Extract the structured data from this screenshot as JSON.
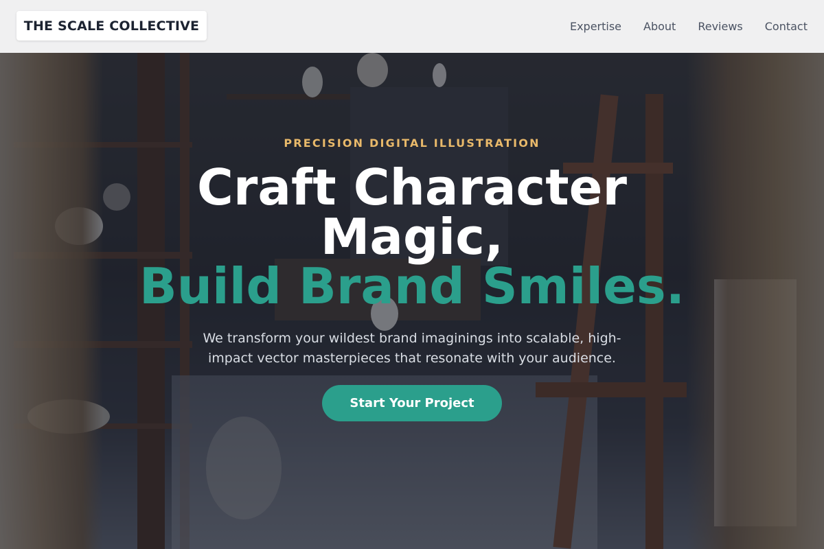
{
  "header": {
    "brand": "THE SCALE COLLECTIVE",
    "nav": [
      {
        "label": "Expertise"
      },
      {
        "label": "About"
      },
      {
        "label": "Reviews"
      },
      {
        "label": "Contact"
      }
    ]
  },
  "hero": {
    "eyebrow": "PRECISION DIGITAL ILLUSTRATION",
    "headline_line1": "Craft Character Magic,",
    "headline_accent": "Build Brand Smiles.",
    "subtitle": "We transform your wildest brand imaginings into scalable, high-impact vector masterpieces that resonate with your audience.",
    "cta_label": "Start Your Project",
    "background_image": "artist-workshop-photo"
  },
  "colors": {
    "accent": "#2b9f8c",
    "eyebrow": "#e9b96a",
    "header_bg": "#f0f0f1",
    "brand_text": "#1c2331"
  }
}
